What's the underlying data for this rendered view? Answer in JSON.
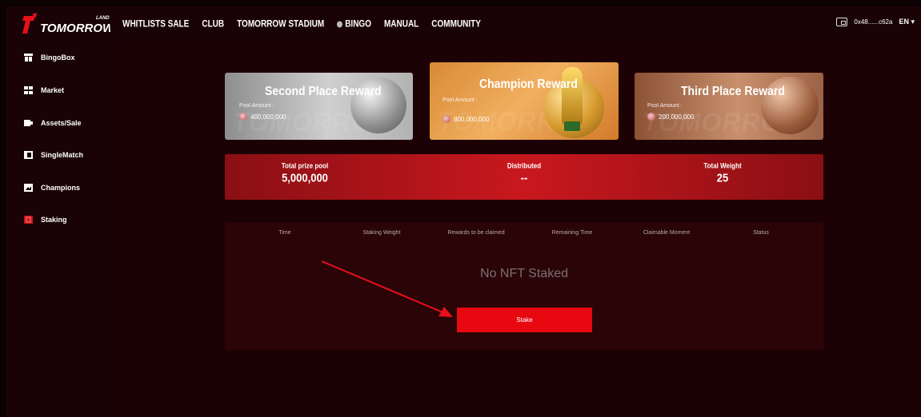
{
  "header": {
    "logo_text": "TOMORROW",
    "logo_sub": "LAND",
    "nav": [
      "WHITLISTS SALE",
      "CLUB",
      "TOMORROW STADIUM",
      "BINGO",
      "MANUAL",
      "COMMUNITY"
    ],
    "wallet_address": "0x48......c62a",
    "language": "EN"
  },
  "sidebar": {
    "items": [
      {
        "label": "BingoBox",
        "icon": "box-icon"
      },
      {
        "label": "Market",
        "icon": "grid-icon"
      },
      {
        "label": "Assets/Sale",
        "icon": "assets-icon"
      },
      {
        "label": "SingleMatch",
        "icon": "match-icon"
      },
      {
        "label": "Champions",
        "icon": "champions-icon"
      },
      {
        "label": "Staking",
        "icon": "staking-icon",
        "active": true
      }
    ]
  },
  "rewards": {
    "second": {
      "title": "Second Place Reward",
      "pool_label": "Pool Amount :",
      "amount": "400,000,000"
    },
    "champion": {
      "title": "Champion Reward",
      "pool_label": "Pool Amount :",
      "amount": "800,000,000"
    },
    "third": {
      "title": "Third Place Reward",
      "pool_label": "Pool Amount :",
      "amount": "200,000,000"
    }
  },
  "stats": {
    "total_prize_pool_label": "Total prize pool",
    "total_prize_pool": "5,000,000",
    "distributed_label": "Distributed",
    "distributed": "--",
    "total_weight_label": "Total Weight",
    "total_weight": "25"
  },
  "table": {
    "columns": [
      "Time",
      "Staking Weight",
      "Rewards to be claimed",
      "Remaining Time",
      "Claimable Moment",
      "Status"
    ],
    "empty_text": "No NFT Staked",
    "stake_label": "Stake"
  },
  "colors": {
    "accent": "#e8080f",
    "panel": "#2a0407",
    "background": "#1d0205"
  }
}
